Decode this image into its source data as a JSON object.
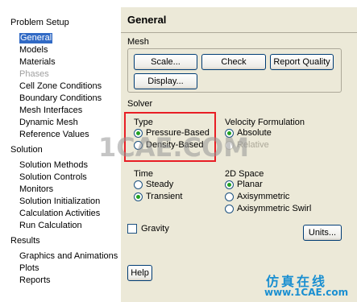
{
  "nav": {
    "problem_setup": "Problem Setup",
    "setup_items": [
      "General",
      "Models",
      "Materials",
      "Phases",
      "Cell Zone Conditions",
      "Boundary Conditions",
      "Mesh Interfaces",
      "Dynamic Mesh",
      "Reference Values"
    ],
    "solution": "Solution",
    "solution_items": [
      "Solution Methods",
      "Solution Controls",
      "Monitors",
      "Solution Initialization",
      "Calculation Activities",
      "Run Calculation"
    ],
    "results": "Results",
    "results_items": [
      "Graphics and Animations",
      "Plots",
      "Reports"
    ],
    "selected": "General",
    "disabled": [
      "Phases"
    ]
  },
  "panel": {
    "title": "General",
    "mesh": {
      "label": "Mesh",
      "scale": "Scale...",
      "check": "Check",
      "report_quality": "Report Quality",
      "display": "Display..."
    },
    "solver": {
      "label": "Solver",
      "type_label": "Type",
      "pressure_based": "Pressure-Based",
      "density_based": "Density-Based",
      "type_selected": "Pressure-Based",
      "velocity_label": "Velocity Formulation",
      "absolute": "Absolute",
      "relative": "Relative",
      "velocity_selected": "Absolute",
      "time_label": "Time",
      "steady": "Steady",
      "transient": "Transient",
      "time_selected": "Transient",
      "space_label": "2D Space",
      "planar": "Planar",
      "axisymmetric": "Axisymmetric",
      "axisymmetric_swirl": "Axisymmetric Swirl",
      "space_selected": "Planar"
    },
    "gravity": {
      "label": "Gravity",
      "checked": false
    },
    "units": "Units...",
    "help": "Help"
  },
  "watermark": {
    "main": "1CAE.COM",
    "corner_cn": "仿真在线",
    "corner_url": "www.1CAE.com"
  },
  "colors": {
    "selection": "#316ac5",
    "panel_bg": "#ece9d8",
    "highlight": "#e81e25",
    "watermark_blue": "#1a8fd1"
  }
}
